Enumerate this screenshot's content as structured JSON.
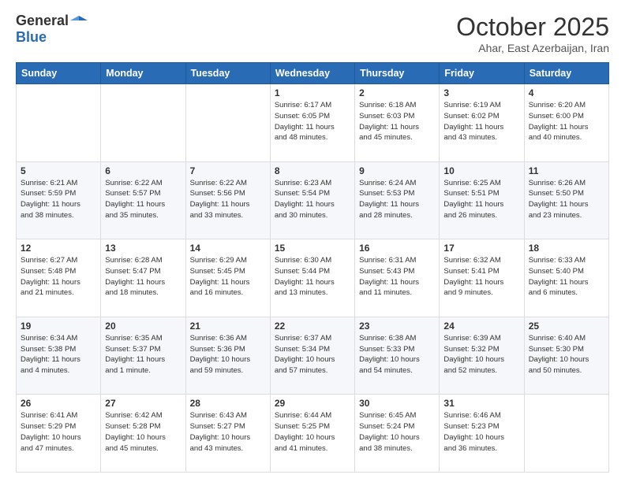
{
  "header": {
    "logo_general": "General",
    "logo_blue": "Blue",
    "title": "October 2025",
    "location": "Ahar, East Azerbaijan, Iran"
  },
  "weekdays": [
    "Sunday",
    "Monday",
    "Tuesday",
    "Wednesday",
    "Thursday",
    "Friday",
    "Saturday"
  ],
  "weeks": [
    [
      {
        "day": "",
        "info": ""
      },
      {
        "day": "",
        "info": ""
      },
      {
        "day": "",
        "info": ""
      },
      {
        "day": "1",
        "info": "Sunrise: 6:17 AM\nSunset: 6:05 PM\nDaylight: 11 hours\nand 48 minutes."
      },
      {
        "day": "2",
        "info": "Sunrise: 6:18 AM\nSunset: 6:03 PM\nDaylight: 11 hours\nand 45 minutes."
      },
      {
        "day": "3",
        "info": "Sunrise: 6:19 AM\nSunset: 6:02 PM\nDaylight: 11 hours\nand 43 minutes."
      },
      {
        "day": "4",
        "info": "Sunrise: 6:20 AM\nSunset: 6:00 PM\nDaylight: 11 hours\nand 40 minutes."
      }
    ],
    [
      {
        "day": "5",
        "info": "Sunrise: 6:21 AM\nSunset: 5:59 PM\nDaylight: 11 hours\nand 38 minutes."
      },
      {
        "day": "6",
        "info": "Sunrise: 6:22 AM\nSunset: 5:57 PM\nDaylight: 11 hours\nand 35 minutes."
      },
      {
        "day": "7",
        "info": "Sunrise: 6:22 AM\nSunset: 5:56 PM\nDaylight: 11 hours\nand 33 minutes."
      },
      {
        "day": "8",
        "info": "Sunrise: 6:23 AM\nSunset: 5:54 PM\nDaylight: 11 hours\nand 30 minutes."
      },
      {
        "day": "9",
        "info": "Sunrise: 6:24 AM\nSunset: 5:53 PM\nDaylight: 11 hours\nand 28 minutes."
      },
      {
        "day": "10",
        "info": "Sunrise: 6:25 AM\nSunset: 5:51 PM\nDaylight: 11 hours\nand 26 minutes."
      },
      {
        "day": "11",
        "info": "Sunrise: 6:26 AM\nSunset: 5:50 PM\nDaylight: 11 hours\nand 23 minutes."
      }
    ],
    [
      {
        "day": "12",
        "info": "Sunrise: 6:27 AM\nSunset: 5:48 PM\nDaylight: 11 hours\nand 21 minutes."
      },
      {
        "day": "13",
        "info": "Sunrise: 6:28 AM\nSunset: 5:47 PM\nDaylight: 11 hours\nand 18 minutes."
      },
      {
        "day": "14",
        "info": "Sunrise: 6:29 AM\nSunset: 5:45 PM\nDaylight: 11 hours\nand 16 minutes."
      },
      {
        "day": "15",
        "info": "Sunrise: 6:30 AM\nSunset: 5:44 PM\nDaylight: 11 hours\nand 13 minutes."
      },
      {
        "day": "16",
        "info": "Sunrise: 6:31 AM\nSunset: 5:43 PM\nDaylight: 11 hours\nand 11 minutes."
      },
      {
        "day": "17",
        "info": "Sunrise: 6:32 AM\nSunset: 5:41 PM\nDaylight: 11 hours\nand 9 minutes."
      },
      {
        "day": "18",
        "info": "Sunrise: 6:33 AM\nSunset: 5:40 PM\nDaylight: 11 hours\nand 6 minutes."
      }
    ],
    [
      {
        "day": "19",
        "info": "Sunrise: 6:34 AM\nSunset: 5:38 PM\nDaylight: 11 hours\nand 4 minutes."
      },
      {
        "day": "20",
        "info": "Sunrise: 6:35 AM\nSunset: 5:37 PM\nDaylight: 11 hours\nand 1 minute."
      },
      {
        "day": "21",
        "info": "Sunrise: 6:36 AM\nSunset: 5:36 PM\nDaylight: 10 hours\nand 59 minutes."
      },
      {
        "day": "22",
        "info": "Sunrise: 6:37 AM\nSunset: 5:34 PM\nDaylight: 10 hours\nand 57 minutes."
      },
      {
        "day": "23",
        "info": "Sunrise: 6:38 AM\nSunset: 5:33 PM\nDaylight: 10 hours\nand 54 minutes."
      },
      {
        "day": "24",
        "info": "Sunrise: 6:39 AM\nSunset: 5:32 PM\nDaylight: 10 hours\nand 52 minutes."
      },
      {
        "day": "25",
        "info": "Sunrise: 6:40 AM\nSunset: 5:30 PM\nDaylight: 10 hours\nand 50 minutes."
      }
    ],
    [
      {
        "day": "26",
        "info": "Sunrise: 6:41 AM\nSunset: 5:29 PM\nDaylight: 10 hours\nand 47 minutes."
      },
      {
        "day": "27",
        "info": "Sunrise: 6:42 AM\nSunset: 5:28 PM\nDaylight: 10 hours\nand 45 minutes."
      },
      {
        "day": "28",
        "info": "Sunrise: 6:43 AM\nSunset: 5:27 PM\nDaylight: 10 hours\nand 43 minutes."
      },
      {
        "day": "29",
        "info": "Sunrise: 6:44 AM\nSunset: 5:25 PM\nDaylight: 10 hours\nand 41 minutes."
      },
      {
        "day": "30",
        "info": "Sunrise: 6:45 AM\nSunset: 5:24 PM\nDaylight: 10 hours\nand 38 minutes."
      },
      {
        "day": "31",
        "info": "Sunrise: 6:46 AM\nSunset: 5:23 PM\nDaylight: 10 hours\nand 36 minutes."
      },
      {
        "day": "",
        "info": ""
      }
    ]
  ]
}
